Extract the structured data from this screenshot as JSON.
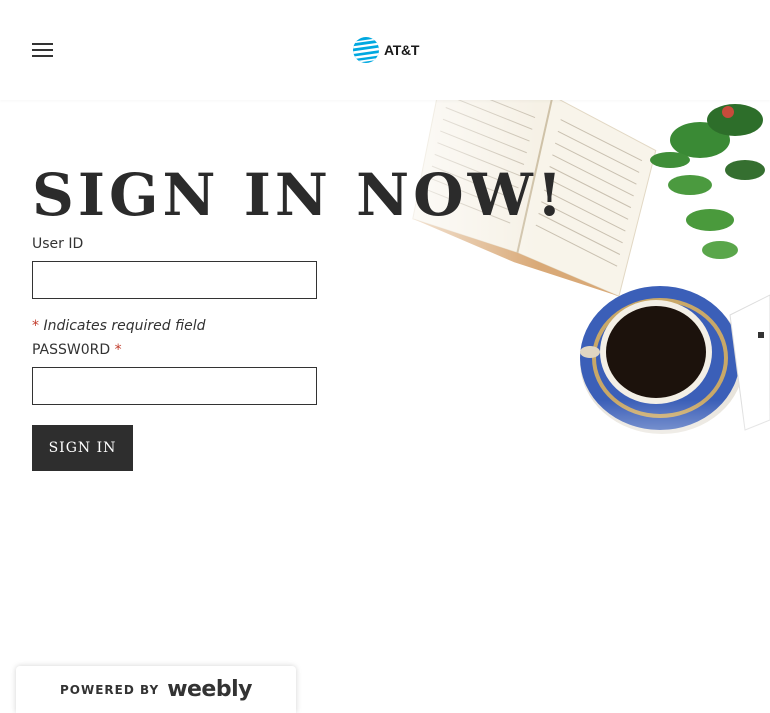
{
  "header": {
    "menu_icon": "hamburger-menu-icon",
    "logo_icon": "att-globe-icon",
    "logo_text": "AT&T",
    "brand_color": "#00a8e0"
  },
  "main": {
    "title": "SIGN IN NOW!",
    "user_id_label": "User ID",
    "user_id_value": "",
    "required_asterisk": "*",
    "required_note": "Indicates required field",
    "password_label": "PASSW0RD",
    "password_asterisk": "*",
    "password_value": "",
    "sign_in_button": "SIGN IN"
  },
  "footer": {
    "powered_by": "POWERED BY",
    "brand": "weebly"
  },
  "colors": {
    "title": "#2b2b2b",
    "button_bg": "#2e2e2e",
    "asterisk": "#c13a2a"
  }
}
